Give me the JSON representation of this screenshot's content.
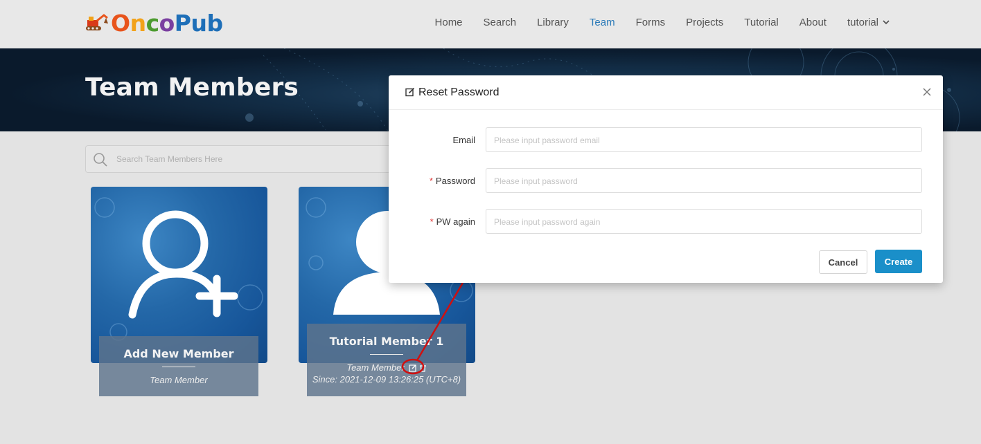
{
  "header": {
    "logo": {
      "text": "OncoPub",
      "letters": [
        {
          "char": "O",
          "color": "#e8541c"
        },
        {
          "char": "n",
          "color": "#f2a21a"
        },
        {
          "char": "c",
          "color": "#4c9b2f"
        },
        {
          "char": "o",
          "color": "#7a3fa0"
        },
        {
          "char": "P",
          "color": "#1e6fb8"
        },
        {
          "char": "u",
          "color": "#1e6fb8"
        },
        {
          "char": "b",
          "color": "#1e6fb8"
        }
      ]
    },
    "nav": {
      "home": "Home",
      "search": "Search",
      "library": "Library",
      "team": "Team",
      "forms": "Forms",
      "projects": "Projects",
      "tutorial": "Tutorial",
      "about": "About",
      "user": "tutorial"
    },
    "active_nav": "Team"
  },
  "banner": {
    "title": "Team Members"
  },
  "search": {
    "placeholder": "Search Team Members Here"
  },
  "cards": [
    {
      "name": "Add New Member",
      "role": "Team Member",
      "icon": "add-user-icon"
    },
    {
      "name": "Tutorial Member 1",
      "role": "Team Member",
      "since": "Since: 2021-12-09 13:26:25 (UTC+8)",
      "icon": "user-avatar-icon"
    }
  ],
  "modal": {
    "title": "Reset Password",
    "fields": {
      "email": {
        "label": "Email",
        "placeholder": "Please input password email",
        "required": false
      },
      "password": {
        "label": "Password",
        "placeholder": "Please input password",
        "required": true
      },
      "pw_again": {
        "label": "PW again",
        "placeholder": "Please input password again",
        "required": true
      }
    },
    "required_mark": "*",
    "cancel_label": "Cancel",
    "create_label": "Create"
  },
  "colors": {
    "accent": "#1a8fc9",
    "nav_active": "#2a7ab8",
    "annotation": "#d01010",
    "required": "#e03c3c"
  }
}
